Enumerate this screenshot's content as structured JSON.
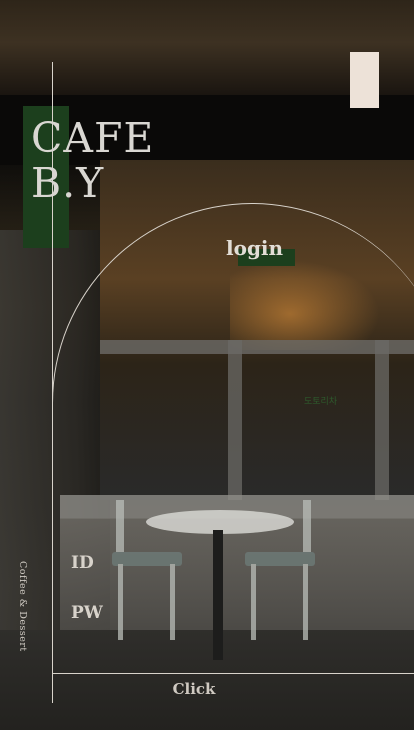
{
  "brand": {
    "line1": "CAFE",
    "line2": "B.Y"
  },
  "tagline": "Coffee & Dessert",
  "login": {
    "title": "login",
    "id_label": "ID",
    "pw_label": "PW",
    "submit_label": "Click"
  },
  "background": {
    "sign_text": "도토리차"
  },
  "colors": {
    "accent_green": "#1c3f1d",
    "accent_cream": "#ede2d8",
    "line_color": "#d8d3cb"
  }
}
